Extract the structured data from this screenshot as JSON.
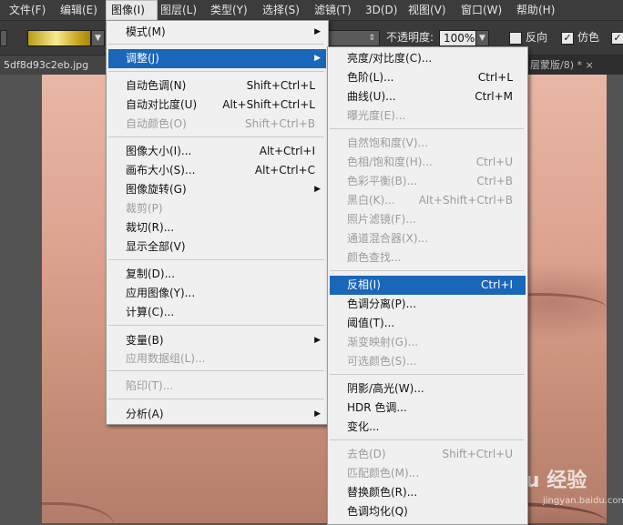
{
  "menubar": {
    "items": [
      "文件(F)",
      "编辑(E)",
      "图像(I)",
      "图层(L)",
      "类型(Y)",
      "选择(S)",
      "滤镜(T)",
      "3D(D)",
      "视图(V)",
      "窗口(W)",
      "帮助(H)"
    ]
  },
  "options": {
    "opacity_label": "不透明度:",
    "opacity_value": "100%",
    "reverse_label": "反向",
    "dither_label": "仿色",
    "checked_mark": "✓"
  },
  "tabs": {
    "left": "5df8d93c2eb.jpg",
    "right": "层蒙版/8) * ×"
  },
  "image_menu": {
    "items": [
      {
        "label": "模式(M)",
        "shortcut": "",
        "submenu": true,
        "disabled": false
      },
      {
        "label": "调整(J)",
        "shortcut": "",
        "submenu": true,
        "disabled": false,
        "highlighted": true
      },
      {
        "label": "自动色调(N)",
        "shortcut": "Shift+Ctrl+L",
        "disabled": false
      },
      {
        "label": "自动对比度(U)",
        "shortcut": "Alt+Shift+Ctrl+L",
        "disabled": false
      },
      {
        "label": "自动颜色(O)",
        "shortcut": "Shift+Ctrl+B",
        "disabled": true
      },
      {
        "label": "图像大小(I)...",
        "shortcut": "Alt+Ctrl+I",
        "disabled": false
      },
      {
        "label": "画布大小(S)...",
        "shortcut": "Alt+Ctrl+C",
        "disabled": false
      },
      {
        "label": "图像旋转(G)",
        "shortcut": "",
        "submenu": true,
        "disabled": false
      },
      {
        "label": "裁剪(P)",
        "shortcut": "",
        "disabled": true
      },
      {
        "label": "裁切(R)...",
        "shortcut": "",
        "disabled": false
      },
      {
        "label": "显示全部(V)",
        "shortcut": "",
        "disabled": false
      },
      {
        "label": "复制(D)...",
        "shortcut": "",
        "disabled": false
      },
      {
        "label": "应用图像(Y)...",
        "shortcut": "",
        "disabled": false
      },
      {
        "label": "计算(C)...",
        "shortcut": "",
        "disabled": false
      },
      {
        "label": "变量(B)",
        "shortcut": "",
        "submenu": true,
        "disabled": false
      },
      {
        "label": "应用数据组(L)...",
        "shortcut": "",
        "disabled": true
      },
      {
        "label": "陷印(T)...",
        "shortcut": "",
        "disabled": true
      },
      {
        "label": "分析(A)",
        "shortcut": "",
        "submenu": true,
        "disabled": false
      }
    ]
  },
  "adjust_menu": {
    "items": [
      {
        "label": "亮度/对比度(C)...",
        "shortcut": "",
        "disabled": false
      },
      {
        "label": "色阶(L)...",
        "shortcut": "Ctrl+L",
        "disabled": false
      },
      {
        "label": "曲线(U)...",
        "shortcut": "Ctrl+M",
        "disabled": false
      },
      {
        "label": "曝光度(E)...",
        "shortcut": "",
        "disabled": true
      },
      {
        "label": "自然饱和度(V)...",
        "shortcut": "",
        "disabled": true
      },
      {
        "label": "色相/饱和度(H)...",
        "shortcut": "Ctrl+U",
        "disabled": true
      },
      {
        "label": "色彩平衡(B)...",
        "shortcut": "Ctrl+B",
        "disabled": true
      },
      {
        "label": "黑白(K)...",
        "shortcut": "Alt+Shift+Ctrl+B",
        "disabled": true
      },
      {
        "label": "照片滤镜(F)...",
        "shortcut": "",
        "disabled": true
      },
      {
        "label": "通道混合器(X)...",
        "shortcut": "",
        "disabled": true
      },
      {
        "label": "颜色查找...",
        "shortcut": "",
        "disabled": true
      },
      {
        "label": "反相(I)",
        "shortcut": "Ctrl+I",
        "disabled": false,
        "highlighted": true
      },
      {
        "label": "色调分离(P)...",
        "shortcut": "",
        "disabled": false
      },
      {
        "label": "阈值(T)...",
        "shortcut": "",
        "disabled": false
      },
      {
        "label": "渐变映射(G)...",
        "shortcut": "",
        "disabled": true
      },
      {
        "label": "可选颜色(S)...",
        "shortcut": "",
        "disabled": true
      },
      {
        "label": "阴影/高光(W)...",
        "shortcut": "",
        "disabled": false
      },
      {
        "label": "HDR 色调...",
        "shortcut": "",
        "disabled": false
      },
      {
        "label": "变化...",
        "shortcut": "",
        "disabled": false
      },
      {
        "label": "去色(D)",
        "shortcut": "Shift+Ctrl+U",
        "disabled": true
      },
      {
        "label": "匹配颜色(M)...",
        "shortcut": "",
        "disabled": true
      },
      {
        "label": "替换颜色(R)...",
        "shortcut": "",
        "disabled": false
      },
      {
        "label": "色调均化(Q)",
        "shortcut": "",
        "disabled": false
      }
    ]
  },
  "watermark": {
    "main": "Baidu 经验",
    "sub": "jingyan.baidu.com"
  },
  "colors": {
    "highlight": "#1a66b8",
    "menu_bg": "#f0f0f0",
    "chrome_dark": "#3c3c3c"
  }
}
